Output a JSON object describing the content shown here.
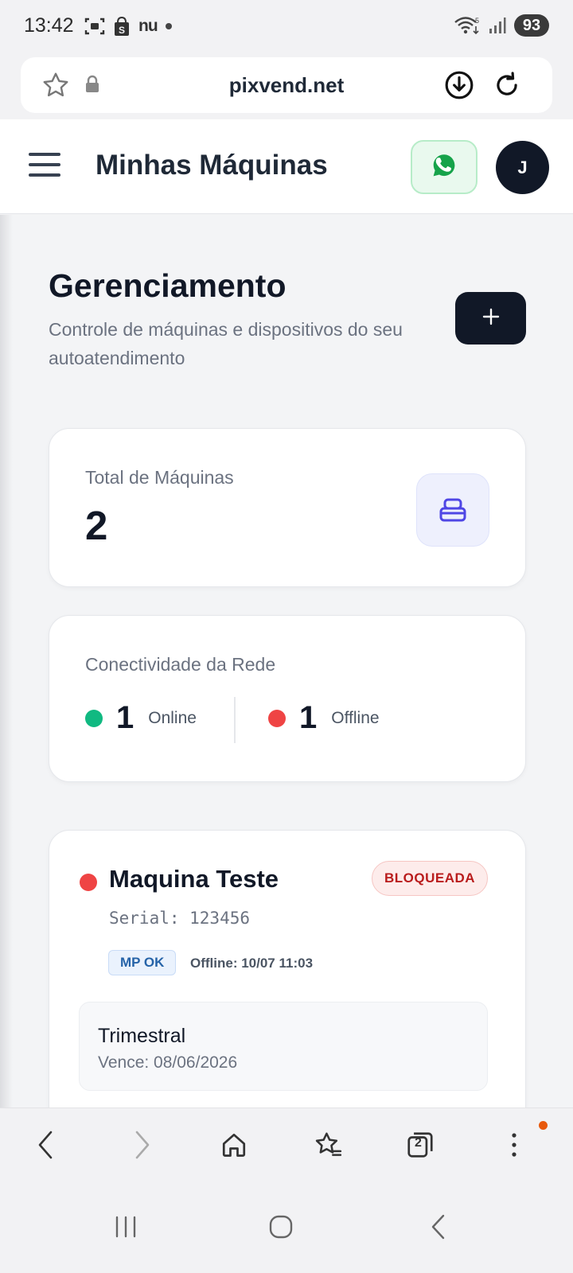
{
  "status_bar": {
    "time": "13:42",
    "notification_text": "nu",
    "battery": "93",
    "icons": [
      "screenshot-icon",
      "shopee-icon",
      "nu-icon",
      "dot-icon",
      "wifi-icon",
      "signal-icon",
      "battery-icon"
    ]
  },
  "browser": {
    "url": "pixvend.net",
    "tab_count": "2"
  },
  "header": {
    "title": "Minhas Máquinas",
    "avatar_initial": "J"
  },
  "page": {
    "title": "Gerenciamento",
    "subtitle": "Controle de máquinas e dispositivos do seu autoatendimento"
  },
  "stats": {
    "total_label": "Total de Máquinas",
    "total_value": "2",
    "network_label": "Conectividade da Rede",
    "online_count": "1",
    "online_label": "Online",
    "offline_count": "1",
    "offline_label": "Offline"
  },
  "machine": {
    "name": "Maquina Teste",
    "status_badge": "BLOQUEADA",
    "serial": "Serial: 123456",
    "payment_chip": "MP OK",
    "offline_since": "Offline: 10/07 11:03",
    "plan_name": "Trimestral",
    "plan_expiry": "Vence: 08/06/2026"
  },
  "colors": {
    "online": "#10b981",
    "offline": "#ef4444",
    "primary_dark": "#111827",
    "accent_indigo": "#4f46e5",
    "whatsapp_green": "#16a34a"
  }
}
